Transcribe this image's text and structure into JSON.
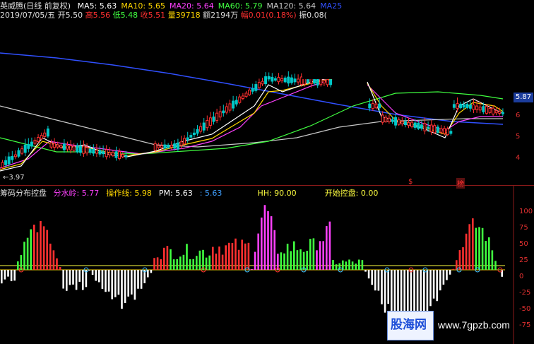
{
  "header": {
    "stock_name": "英威腾(日线 前复权)",
    "ma": [
      {
        "label": "MA5:",
        "value": "5.63",
        "color": "#ffffff"
      },
      {
        "label": "MA10:",
        "value": "5.65",
        "color": "#ffd700"
      },
      {
        "label": "MA20:",
        "value": "5.64",
        "color": "#ff40ff"
      },
      {
        "label": "MA60:",
        "value": "5.79",
        "color": "#40ff40"
      },
      {
        "label": "MA120:",
        "value": "5.64",
        "color": "#c8c8c8"
      },
      {
        "label": "MA25",
        "value": "",
        "color": "#3050ff"
      }
    ]
  },
  "quote": {
    "date": "2019/07/05/五",
    "open_label": "开",
    "open": "5.50",
    "high_label": "高",
    "high": "5.56",
    "low_label": "低",
    "low": "5.48",
    "close_label": "收",
    "close": "5.51",
    "volume_label": "量",
    "volume": "39718",
    "amount_label": "额",
    "amount": "2194万",
    "change_label": "幅",
    "change": "0.01",
    "change_pct": "(0.18%)",
    "amplitude_label": "振",
    "amplitude": "0.08("
  },
  "price_axis": {
    "current": "5.87",
    "ticks": [
      "6",
      "5",
      "4"
    ]
  },
  "price_chart": {
    "low_marker": "←3.97",
    "tag1": "$",
    "tag2": "榜"
  },
  "indicator": {
    "title": "筹码分布控盘",
    "items": [
      {
        "label": "分水岭:",
        "value": "5.77",
        "color": "#ff40ff"
      },
      {
        "label": "操作线:",
        "value": "5.98",
        "color": "#ffd700"
      },
      {
        "label": "PM:",
        "value": "5.63",
        "color": "#ffffff"
      },
      {
        "label": ":",
        "value": "5.63",
        "color": "#40a0ff"
      },
      {
        "label": "HH:",
        "value": "90.00",
        "color": "#ffff40"
      },
      {
        "label": "开始控盘:",
        "value": "0.00",
        "color": "#ffff40"
      }
    ],
    "axis_ticks": [
      "100",
      "75",
      "50",
      "25",
      "0",
      "-25",
      "-50",
      "-75"
    ]
  },
  "watermark": {
    "brand": "股海网",
    "url": "www.7gpzb.com"
  },
  "colors": {
    "up": "#ff3030",
    "down": "#00c8c8",
    "bg": "#000000",
    "axis_red": "#e03030"
  }
}
